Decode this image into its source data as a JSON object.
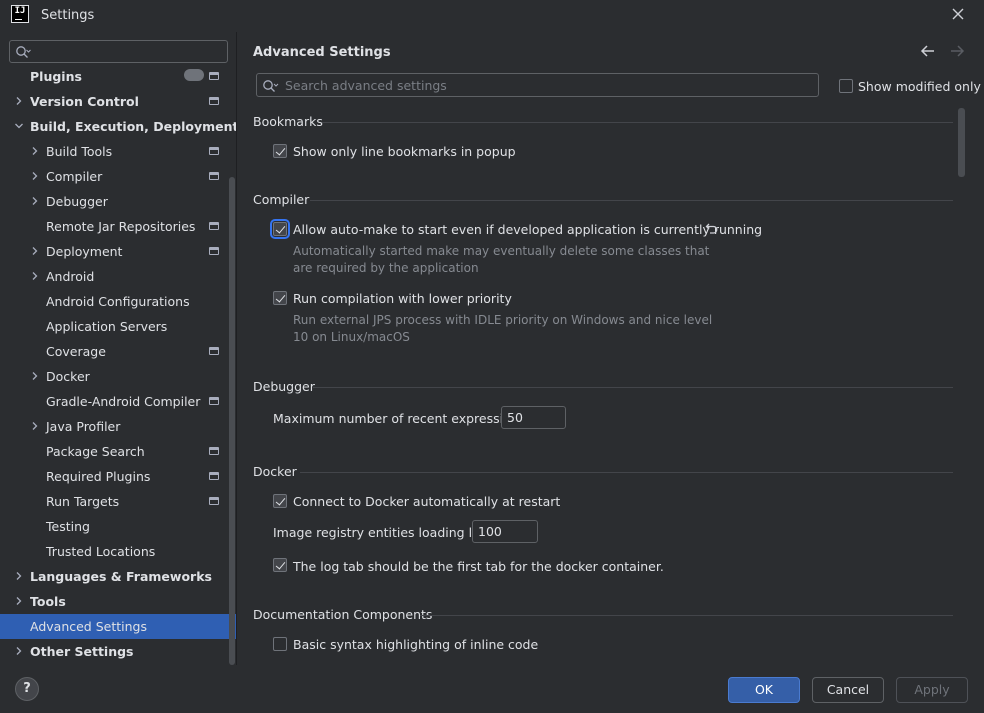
{
  "window": {
    "title": "Settings",
    "app_icon_text": "IJ"
  },
  "sidebar": {
    "search_placeholder": "",
    "items": [
      {
        "label": "Plugins",
        "level": 0,
        "expandable": false,
        "bold": true,
        "badge": true,
        "project": true
      },
      {
        "label": "Version Control",
        "level": 0,
        "expandable": true,
        "expanded": false,
        "bold": true,
        "project": true
      },
      {
        "label": "Build, Execution, Deployment",
        "level": 0,
        "expandable": true,
        "expanded": true,
        "bold": true,
        "project": false
      },
      {
        "label": "Build Tools",
        "level": 1,
        "expandable": true,
        "expanded": false,
        "project": true
      },
      {
        "label": "Compiler",
        "level": 1,
        "expandable": true,
        "expanded": false,
        "project": true
      },
      {
        "label": "Debugger",
        "level": 1,
        "expandable": true,
        "expanded": false,
        "project": false
      },
      {
        "label": "Remote Jar Repositories",
        "level": 1,
        "expandable": false,
        "project": true
      },
      {
        "label": "Deployment",
        "level": 1,
        "expandable": true,
        "expanded": false,
        "project": true
      },
      {
        "label": "Android",
        "level": 1,
        "expandable": true,
        "expanded": false,
        "project": false
      },
      {
        "label": "Android Configurations",
        "level": 1,
        "expandable": false,
        "project": false
      },
      {
        "label": "Application Servers",
        "level": 1,
        "expandable": false,
        "project": false
      },
      {
        "label": "Coverage",
        "level": 1,
        "expandable": false,
        "project": true
      },
      {
        "label": "Docker",
        "level": 1,
        "expandable": true,
        "expanded": false,
        "project": false
      },
      {
        "label": "Gradle-Android Compiler",
        "level": 1,
        "expandable": false,
        "project": true
      },
      {
        "label": "Java Profiler",
        "level": 1,
        "expandable": true,
        "expanded": false,
        "project": false
      },
      {
        "label": "Package Search",
        "level": 1,
        "expandable": false,
        "project": true
      },
      {
        "label": "Required Plugins",
        "level": 1,
        "expandable": false,
        "project": true
      },
      {
        "label": "Run Targets",
        "level": 1,
        "expandable": false,
        "project": true
      },
      {
        "label": "Testing",
        "level": 1,
        "expandable": false,
        "project": false
      },
      {
        "label": "Trusted Locations",
        "level": 1,
        "expandable": false,
        "project": false
      },
      {
        "label": "Languages & Frameworks",
        "level": 0,
        "expandable": true,
        "expanded": false,
        "bold": true,
        "project": false
      },
      {
        "label": "Tools",
        "level": 0,
        "expandable": true,
        "expanded": false,
        "bold": true,
        "project": false
      },
      {
        "label": "Advanced Settings",
        "level": 0,
        "expandable": false,
        "bold": false,
        "selected": true,
        "project": false
      },
      {
        "label": "Other Settings",
        "level": 0,
        "expandable": true,
        "expanded": false,
        "bold": true,
        "project": false
      }
    ]
  },
  "main": {
    "title": "Advanced Settings",
    "search_placeholder": "Search advanced settings",
    "show_modified_label": "Show modified only",
    "show_modified_checked": false,
    "sections": {
      "bookmarks": "Bookmarks",
      "compiler": "Compiler",
      "debugger": "Debugger",
      "docker": "Docker",
      "documentation": "Documentation Components"
    },
    "options": {
      "show_line_bookmarks": {
        "label": "Show only line bookmarks in popup",
        "checked": true
      },
      "auto_make": {
        "label": "Allow auto-make to start even if developed application is currently running",
        "checked": true,
        "desc_line1": "Automatically started make may eventually delete some classes that",
        "desc_line2": "are required by the application"
      },
      "lower_priority": {
        "label": "Run compilation with lower priority",
        "checked": true,
        "desc_line1": "Run external JPS process with IDLE priority on Windows and nice level",
        "desc_line2": "10 on Linux/macOS"
      },
      "max_recent_expr": {
        "label": "Maximum number of recent expressions:",
        "value": "50"
      },
      "docker_connect": {
        "label": "Connect to Docker automatically at restart",
        "checked": true
      },
      "docker_registry_limit": {
        "label": "Image registry entities loading limit:",
        "value": "100"
      },
      "docker_log_tab": {
        "label": "The log tab should be the first tab for the docker container.",
        "checked": true
      },
      "basic_syntax": {
        "label": "Basic syntax highlighting of inline code",
        "checked": false
      }
    }
  },
  "footer": {
    "help_label": "?",
    "ok_label": "OK",
    "cancel_label": "Cancel",
    "apply_label": "Apply"
  }
}
